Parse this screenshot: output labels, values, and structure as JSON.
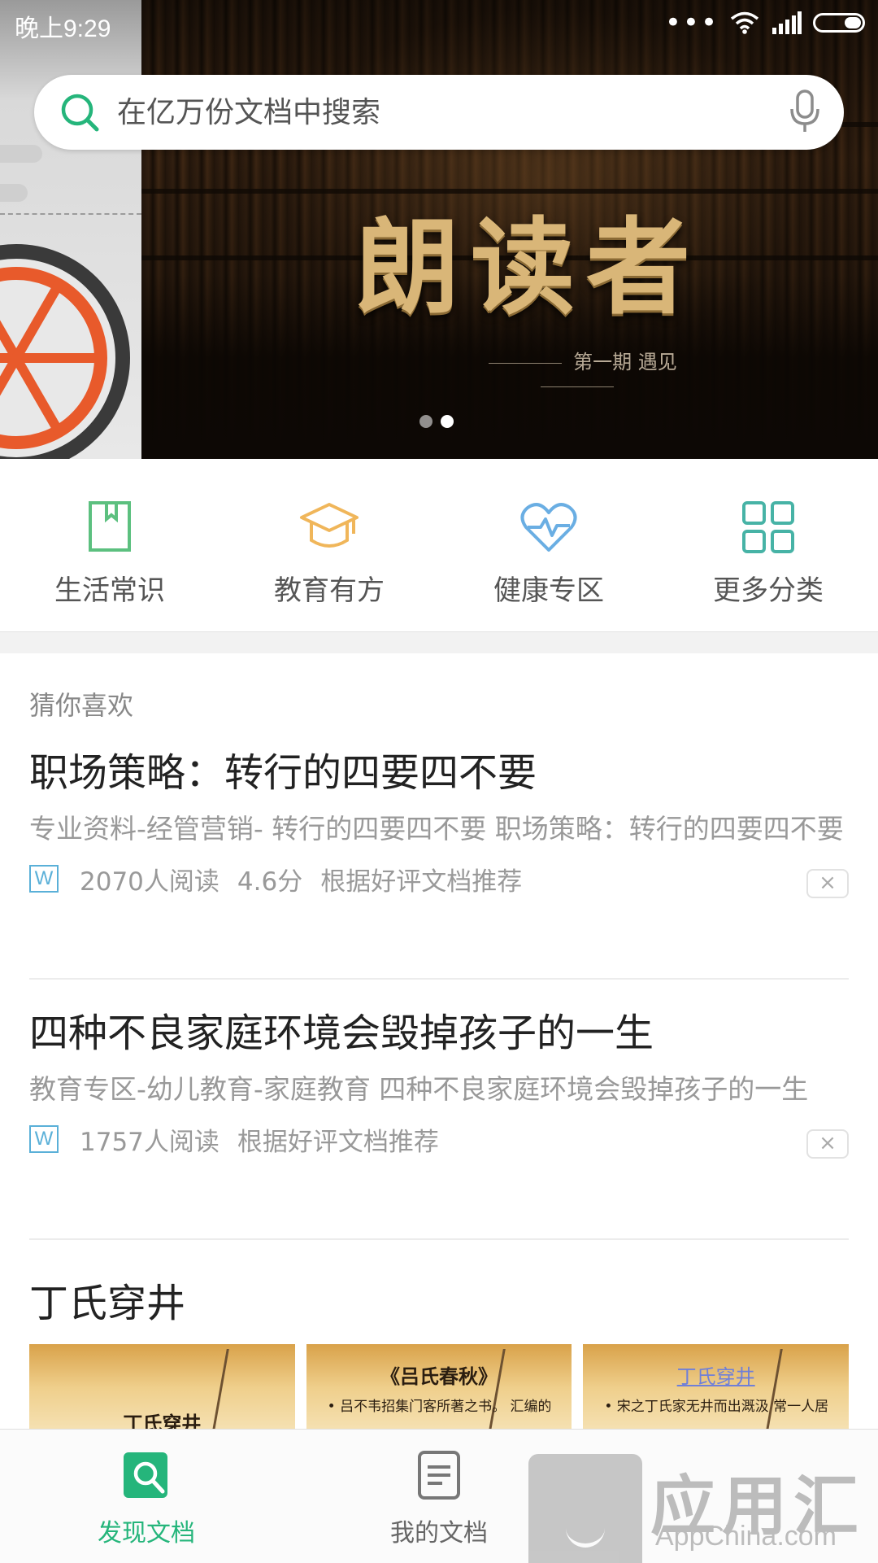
{
  "status_bar": {
    "time": "晚上9:29",
    "more": "•••"
  },
  "search": {
    "placeholder": "在亿万份文档中搜索"
  },
  "banner": {
    "title": "朗读者",
    "subtitle": "第一期 遇见",
    "slide_count": 2,
    "active_slide": 2
  },
  "categories": [
    {
      "label": "生活常识",
      "icon": "bookmark-book-icon",
      "color": "#5cc07f"
    },
    {
      "label": "教育有方",
      "icon": "graduation-cap-icon",
      "color": "#f0b65a"
    },
    {
      "label": "健康专区",
      "icon": "heart-pulse-icon",
      "color": "#6aaee3"
    },
    {
      "label": "更多分类",
      "icon": "grid-icon",
      "color": "#47b3a6"
    }
  ],
  "feed": {
    "section_label": "猜你喜欢",
    "items": [
      {
        "title": "职场策略：转行的四要四不要",
        "desc": "专业资料-经管营销- 转行的四要四不要 职场策略：转行的四要四不要",
        "file_type": "W",
        "reads": "2070人阅读",
        "score": "4.6分",
        "reason": "根据好评文档推荐",
        "close": "×"
      },
      {
        "title": "四种不良家庭环境会毁掉孩子的一生",
        "desc": "教育专区-幼儿教育-家庭教育 四种不良家庭环境会毁掉孩子的一生",
        "file_type": "W",
        "reads": "1757人阅读",
        "reason": "根据好评文档推荐",
        "close": "×"
      }
    ],
    "item3": {
      "title": "丁氏穿井",
      "thumbs": [
        {
          "text": "丁氏穿井",
          "line": ""
        },
        {
          "text": "《吕氏春秋》",
          "line": "• 吕不韦招集门客所著之书。 汇编的八览、六论、十二"
        },
        {
          "text": "丁氏穿井",
          "line": "• 宋之丁氏家无井而出溉汲 常一人居外及其家穿井告人"
        }
      ]
    }
  },
  "bottom_nav": {
    "items": [
      {
        "label": "发现文档",
        "icon": "discover-search-icon",
        "active": true
      },
      {
        "label": "我的文档",
        "icon": "document-icon",
        "active": false
      }
    ]
  },
  "watermark": {
    "text": "应用汇",
    "sub": "AppChina.com"
  },
  "colors": {
    "accent": "#25b57b",
    "banner_gold": "#d9b678"
  }
}
